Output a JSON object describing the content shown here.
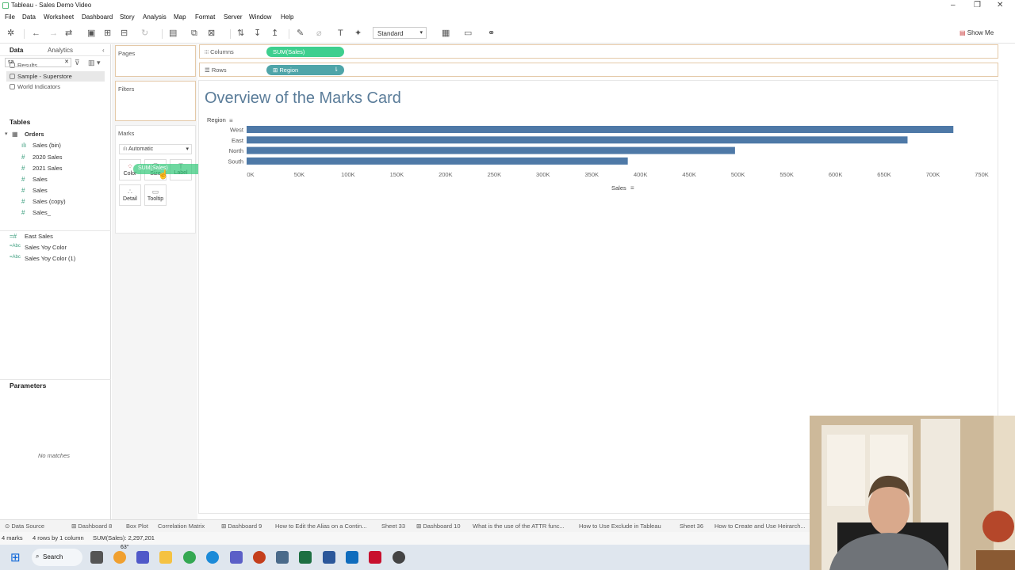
{
  "app": {
    "title": "Tableau - Sales Demo Video",
    "menu": [
      "File",
      "Data",
      "Worksheet",
      "Dashboard",
      "Story",
      "Analysis",
      "Map",
      "Format",
      "Server",
      "Window",
      "Help"
    ]
  },
  "toolbar": {
    "fit_select": "Standard",
    "show_me": "Show Me"
  },
  "left_pane": {
    "tabs": [
      "Data",
      "Analytics"
    ],
    "sources": [
      "Results",
      "Sample - Superstore",
      "World Indicators"
    ],
    "search_value": "sa",
    "tables_header": "Tables",
    "table_name": "Orders",
    "fields": [
      "Sales (bin)",
      "2020 Sales",
      "2021 Sales",
      "Sales",
      "Sales",
      "Sales (copy)",
      "Sales_"
    ],
    "calc_fields": [
      "East Sales",
      "Sales Yoy Color",
      "Sales Yoy Color (1)"
    ],
    "parameters_header": "Parameters",
    "no_matches": "No matches"
  },
  "cards": {
    "pages": "Pages",
    "filters": "Filters",
    "marks": "Marks",
    "mark_type": "Automatic",
    "buttons": [
      "Color",
      "Size",
      "Label",
      "Detail",
      "Tooltip"
    ],
    "drag_pill": "SUM(Sales)"
  },
  "shelves": {
    "columns_label": "Columns",
    "columns_pill": "SUM(Sales)",
    "rows_label": "Rows",
    "rows_pill": "Region"
  },
  "chart_data": {
    "type": "bar",
    "title": "Overview of the Marks Card",
    "ylabel": "Region",
    "xlabel": "Sales",
    "categories": [
      "West",
      "East",
      "North",
      "South"
    ],
    "values": [
      725000,
      678000,
      501000,
      391000
    ],
    "xlim": [
      0,
      750000
    ],
    "x_ticks": [
      "0K",
      "50K",
      "100K",
      "150K",
      "200K",
      "250K",
      "300K",
      "350K",
      "400K",
      "450K",
      "500K",
      "550K",
      "600K",
      "650K",
      "700K",
      "750K"
    ],
    "bar_color": "#4e79a7"
  },
  "sheet_tabs": [
    "Data Source",
    "Dashboard 8",
    "Box Plot",
    "Correlation Matrix",
    "Dashboard 9",
    "How to Edit the Alias on a Contin...",
    "Sheet 33",
    "Dashboard 10",
    "What is the use of the ATTR func...",
    "How to Use Exclude in Tableau",
    "Sheet 36",
    "How to Create and Use Heirarch..."
  ],
  "status": {
    "marks": "4 marks",
    "dims": "4 rows by 1 column",
    "sum": "SUM(Sales): 2,297,201"
  },
  "taskbar": {
    "search": "Search",
    "weather": "63°"
  },
  "colors": {
    "accent_green": "#3ecf8e",
    "rows_pill": "#4fa5a9",
    "title_blue": "#5a7c99"
  }
}
